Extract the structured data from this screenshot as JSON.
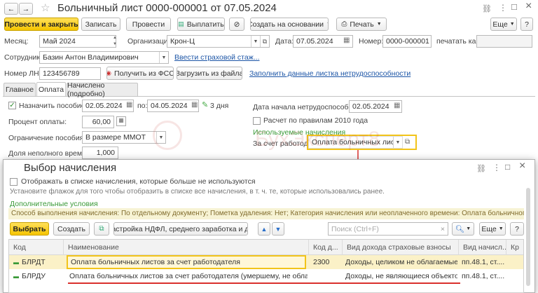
{
  "window": {
    "title": "Больничный лист 0000-000001 от 07.05.2024",
    "nav_back": "←",
    "nav_fwd": "→",
    "star": "☆",
    "link_icon": "🔗",
    "menu_icon": "⋮",
    "maximize_icon": "□",
    "close_icon": "×"
  },
  "toolbar": {
    "post_close": "Провести и закрыть",
    "save": "Записать",
    "post": "Провести",
    "pay": "Выплатить",
    "create_based": "Создать на основании",
    "print": "Печать",
    "more": "Еще",
    "help": "?"
  },
  "form": {
    "month_label": "Месяц:",
    "month_value": "Май 2024",
    "org_label": "Организация:",
    "org_value": "Крон-Ц",
    "date_label": "Дата:",
    "date_value": "07.05.2024",
    "number_label": "Номер:",
    "number_value": "0000-000001",
    "print_as_label": "печатать как:",
    "employee_label": "Сотрудник:",
    "employee_value": "Базин Антон Владимирович",
    "insurance_link": "Ввести страховой стаж...",
    "ln_label": "Номер ЛН:",
    "ln_value": "123456789",
    "get_fss": "Получить из ФСС",
    "load_file": "Загрузить из файла",
    "fill_link": "Заполнить данные листка нетрудоспособности"
  },
  "tabs": [
    "Главное",
    "Оплата",
    "Начислено (подробно)"
  ],
  "payment": {
    "assign_label": "Назначить пособие с:",
    "from_date": "02.05.2024",
    "to_label": "по:",
    "to_date": "04.05.2024",
    "days": "3 дня",
    "percent_label": "Процент оплаты:",
    "percent_value": "60,00",
    "limit_label": "Ограничение пособия:",
    "limit_value": "В размере ММОТ",
    "parttime_label": "Доля неполного времени:",
    "parttime_value": "1,000",
    "start_label": "Дата начала нетрудоспособности:",
    "start_value": "02.05.2024",
    "rules2010_label": "Расчет по правилам 2010 года",
    "used_accruals": "Используемые начисления",
    "employer_label": "За счет работодат.:",
    "employer_value": "Оплата больничных листов за"
  },
  "watermark": "БухЭксперт8",
  "dialog": {
    "title": "Выбор начисления",
    "show_unused": "Отображать в списке начисления, которые больше не используются",
    "hint": "Установите флажок для того чтобы отобразить в списке все начисления, в т. ч. те, которые использовались ранее.",
    "extra_conditions": "Дополнительные условия",
    "filter_text": "Способ выполнения начисления: По отдельному документу; Пометка удаления: Нет; Категория начисления или неоплаченного времени: Оплата больничного листа за счет работод...",
    "select": "Выбрать",
    "create": "Создать",
    "ndfl_settings": "Настройка НДФЛ, среднего заработка и др.",
    "search_placeholder": "Поиск (Ctrl+F)",
    "more": "Еще",
    "help": "?",
    "columns": [
      "Код",
      "Наименование",
      "Код д...",
      "Вид дохода страховые взносы",
      "Вид начисл...",
      "Кр"
    ],
    "rows": [
      {
        "code": "БЛРДТ",
        "name": "Оплата больничных листов за счет работодателя",
        "income_code": "2300",
        "income_type": "Доходы, целиком не облагаемые стр...",
        "accrual_type": "пп.48.1, ст...."
      },
      {
        "code": "БЛРДУ",
        "name": "Оплата больничных листов за счет работодателя (умершему, не облагается НДФЛ)",
        "income_code": "",
        "income_type": "Доходы, не являющиеся объектом о...",
        "accrual_type": "пп.48.1, ст...."
      }
    ]
  },
  "colors": {
    "accent_yellow": "#f5c400",
    "link_blue": "#1c55a6",
    "green": "#3a9a38",
    "annotation_red": "#d9302c"
  }
}
